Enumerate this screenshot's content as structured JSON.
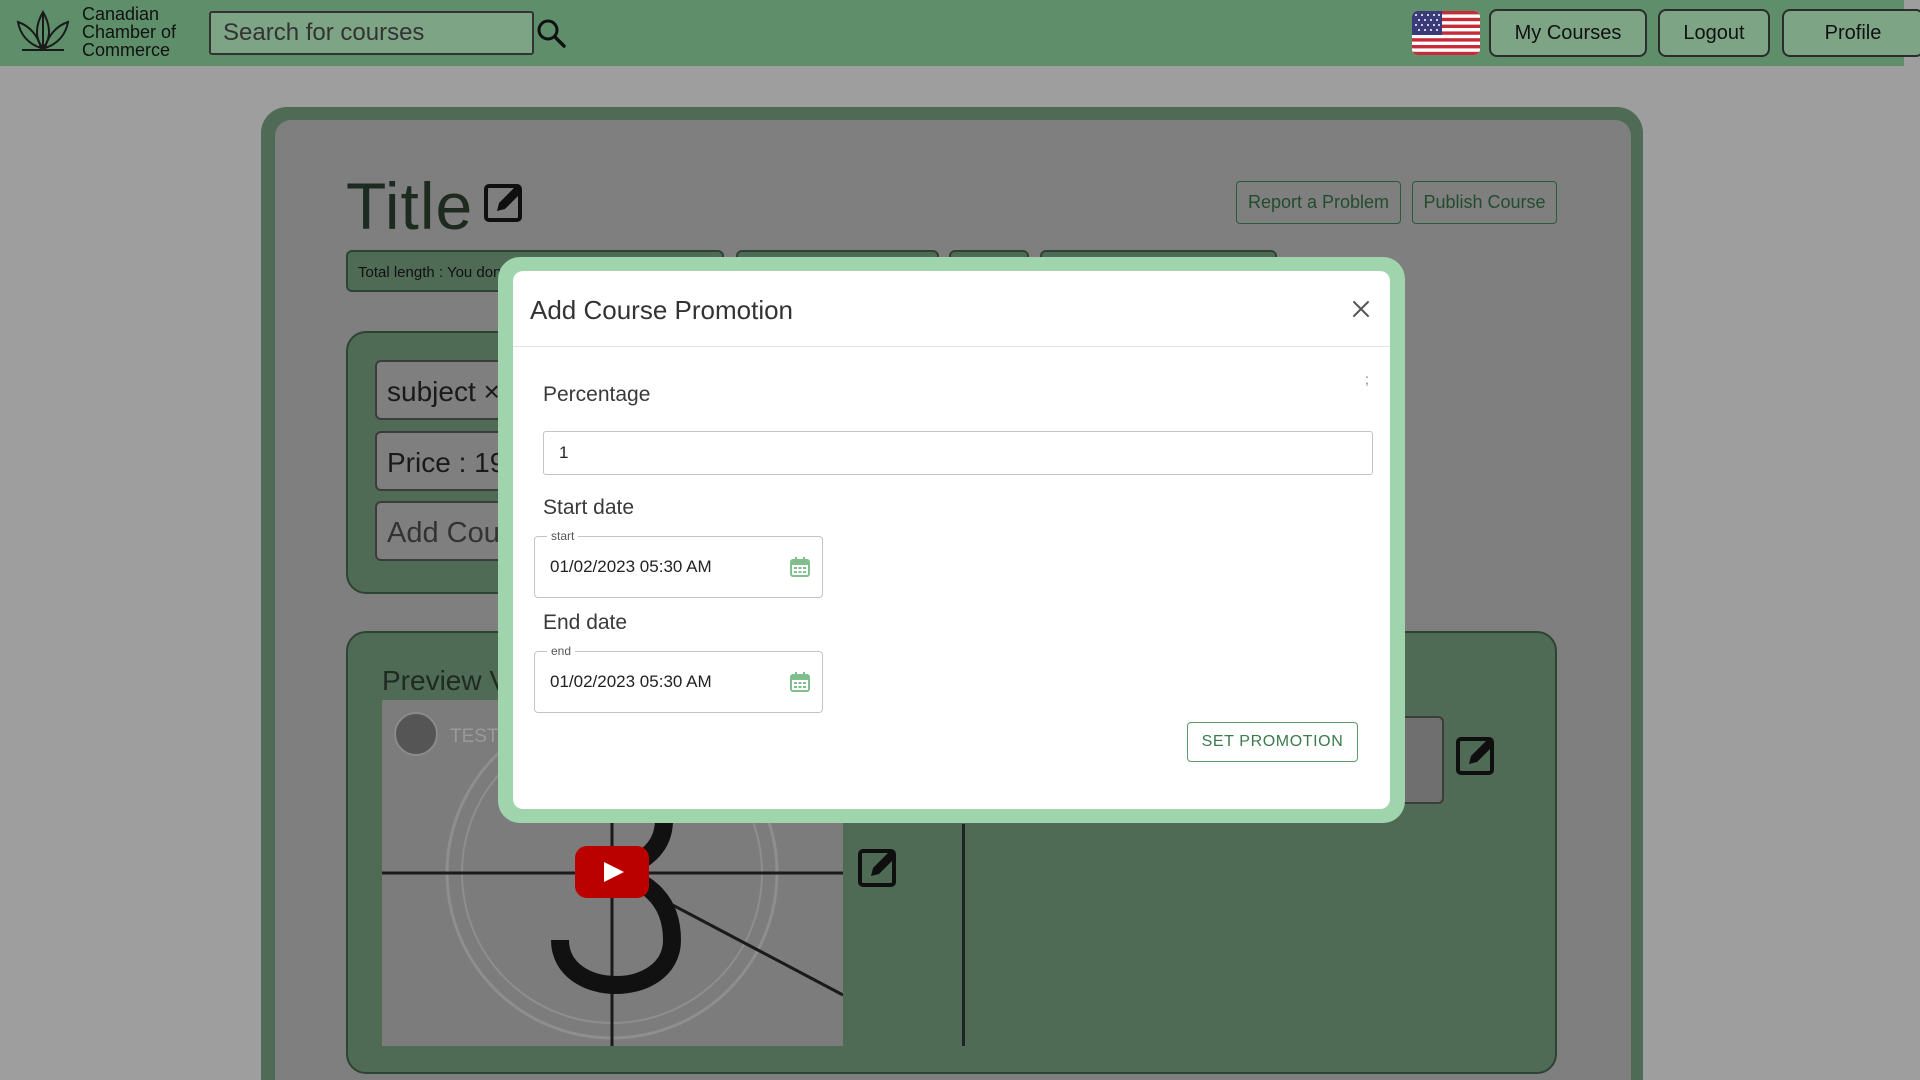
{
  "header": {
    "logo_text": "Canadian\nChamber of\nCommerce",
    "search_placeholder": "Search for courses",
    "buttons": {
      "my_courses": "My Courses",
      "logout": "Logout",
      "profile": "Profile"
    }
  },
  "course": {
    "title": "Title",
    "report_label": "Report a Problem",
    "publish_label": "Publish Course",
    "chips": [
      "Total length : You don",
      "",
      "",
      ""
    ],
    "subject_chip": "subject ×",
    "price": "Price : 199",
    "add_course": "Add Cour",
    "preview_label": "Preview V",
    "video_title": "TEST"
  },
  "modal": {
    "title": "Add Course Promotion",
    "semicolon": ";",
    "percentage_label": "Percentage",
    "percentage_value": "1",
    "start_label": "Start date",
    "start_legend": "start",
    "start_value": "01/02/2023 05:30 AM",
    "end_label": "End date",
    "end_legend": "end",
    "end_value": "01/02/2023 05:30 AM",
    "submit_label": "SET PROMOTION"
  },
  "colors": {
    "header_bg": "#5f8f6a",
    "modal_frame": "#9fd4ad",
    "accent_green": "#3b7a4c",
    "overlay": "#7f7f7f"
  },
  "icons": [
    "logo-icon",
    "search-icon",
    "us-flag-icon",
    "edit-icon",
    "close-icon",
    "calendar-icon",
    "play-icon"
  ]
}
